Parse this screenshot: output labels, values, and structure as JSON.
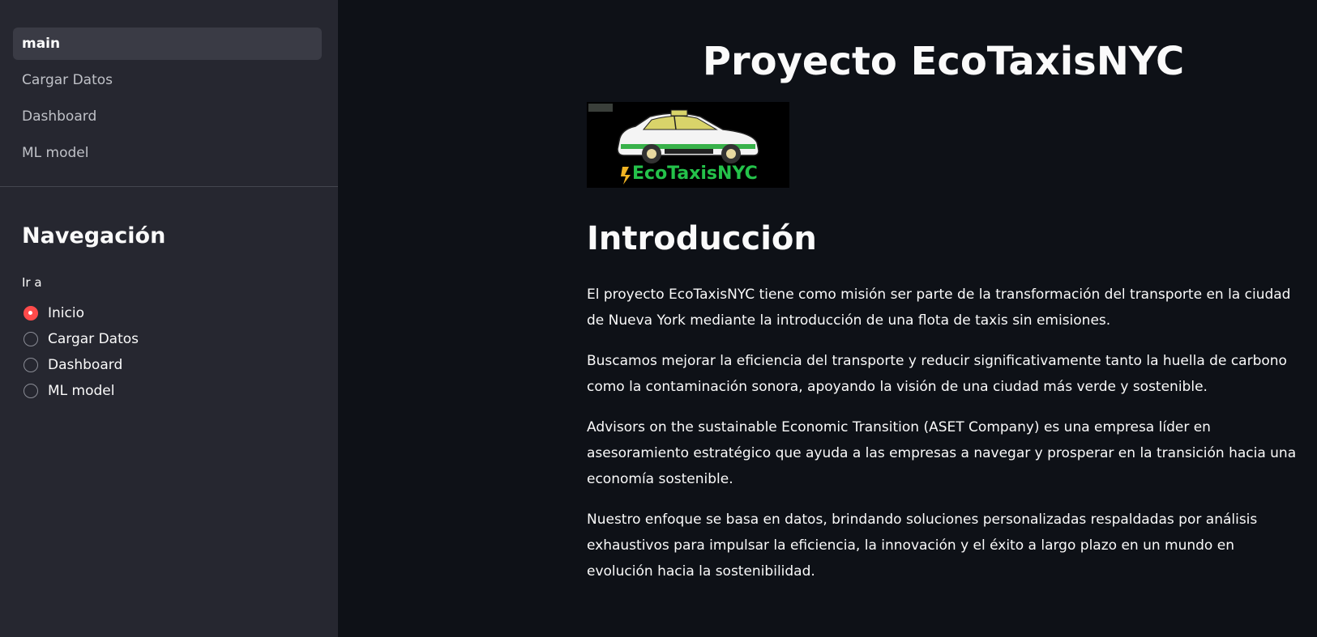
{
  "sidebar": {
    "nav_items": [
      {
        "label": "main",
        "active": true
      },
      {
        "label": "Cargar Datos",
        "active": false
      },
      {
        "label": "Dashboard",
        "active": false
      },
      {
        "label": "ML model",
        "active": false
      }
    ],
    "heading": "Navegación",
    "radio_label": "Ir a",
    "radio_options": [
      {
        "label": "Inicio",
        "selected": true
      },
      {
        "label": "Cargar Datos",
        "selected": false
      },
      {
        "label": "Dashboard",
        "selected": false
      },
      {
        "label": "ML model",
        "selected": false
      }
    ]
  },
  "main": {
    "title": "Proyecto EcoTaxisNYC",
    "logo_text": "EcoTaxisNYC",
    "section_heading": "Introducción",
    "paragraphs": [
      "El proyecto EcoTaxisNYC tiene como misión ser parte de la transformación del transporte en la ciudad de Nueva York mediante la introducción de una flota de taxis sin emisiones.",
      "Buscamos mejorar la eficiencia del transporte y reducir significativamente tanto la huella de carbono como la contaminación sonora, apoyando la visión de una ciudad más verde y sostenible.",
      "Advisors on the sustainable Economic Transition (ASET Company) es una empresa líder en asesoramiento estratégico que ayuda a las empresas a navegar y prosperar en la transición hacia una economía sostenible.",
      "Nuestro enfoque se basa en datos, brindando soluciones personalizadas respaldadas por análisis exhaustivos para impulsar la eficiencia, la innovación y el éxito a largo plazo en un mundo en evolución hacia la sostenibilidad."
    ]
  },
  "colors": {
    "background": "#0e1117",
    "sidebar": "#262730",
    "accent": "#ff4b4b",
    "logo_green": "#24c24a"
  }
}
